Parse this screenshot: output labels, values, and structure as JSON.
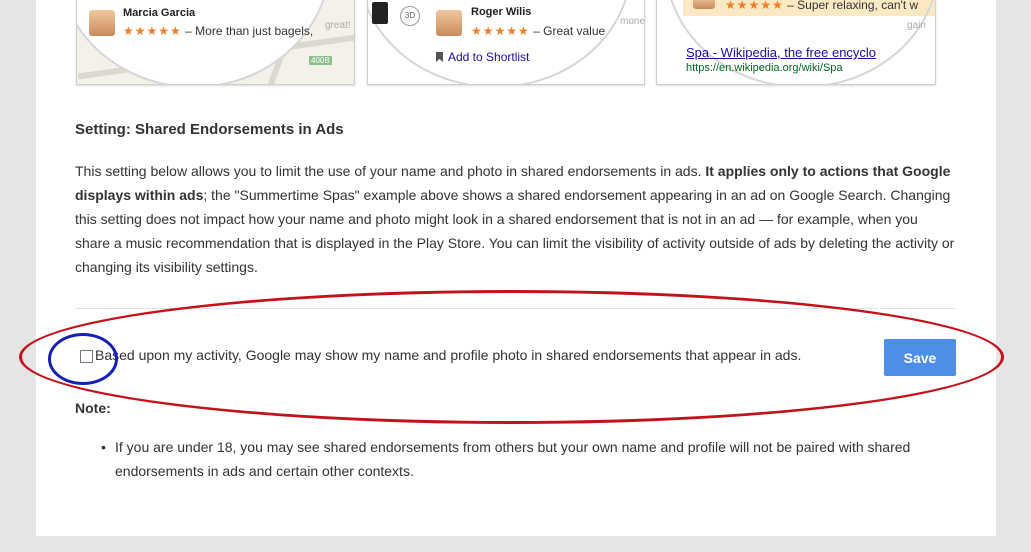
{
  "examples": {
    "card1": {
      "reviewer": "Marcia Garcia",
      "stars": "★★★★★",
      "text": "– More than just bagels,",
      "faint": "great!",
      "map_label": "400B"
    },
    "card2": {
      "reviewer": "Roger Wilis",
      "stars": "★★★★★",
      "text": "– Great value",
      "faint": "mone",
      "shortlist_label": "Add to Shortlist",
      "badge": "3D"
    },
    "card3": {
      "stars": "★★★★★",
      "text": "– Super relaxing, can't w",
      "faint": "gain",
      "wiki_title": "Spa - Wikipedia, the free encyclo",
      "wiki_url": "https://en.wikipedia.org/wiki/Spa"
    }
  },
  "section": {
    "title": "Setting: Shared Endorsements in Ads",
    "desc_part1": "This setting below allows you to limit the use of your name and photo in shared endorsements in ads. ",
    "desc_bold": "It applies only to actions that Google displays within ads",
    "desc_part2": "; the \"Summertime Spas\" example above shows a shared endorsement appearing in an ad on Google Search. Changing this setting does not impact how your name and photo might look in a shared endorsement that is not in an ad — for example, when you share a music recommendation that is displayed in the Play Store. You can limit the visibility of activity outside of ads by deleting the activity or changing its visibility settings."
  },
  "setting": {
    "checkbox_label": "Based upon my activity, Google may show my name and profile photo in shared endorsements that appear in ads.",
    "checked": false,
    "save_label": "Save"
  },
  "note": {
    "title": "Note:",
    "items": [
      "If you are under 18, you may see shared endorsements from others but your own name and profile will not be paired with shared endorsements in ads and certain other contexts."
    ]
  },
  "colors": {
    "save_button": "#4d8fe8",
    "annotation_red": "#c4121a",
    "annotation_blue": "#1520b8",
    "star": "#f47c21"
  }
}
